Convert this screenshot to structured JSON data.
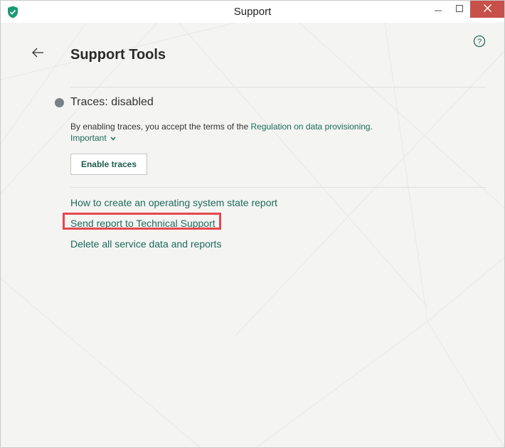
{
  "window": {
    "title": "Support",
    "controls": {
      "minimize": "minimize",
      "maximize": "maximize",
      "close": "close"
    }
  },
  "header": {
    "title": "Support Tools",
    "back_icon": "back-arrow-icon",
    "help_icon": "help-icon"
  },
  "traces": {
    "status": "Traces: disabled",
    "status_color": "#7a8186",
    "terms_prefix": "By enabling traces, you accept the terms of the ",
    "terms_link": "Regulation on data provisioning",
    "terms_suffix": ".",
    "important_label": "Important",
    "enable_button": "Enable traces"
  },
  "actions": [
    {
      "label": "How to create an operating system state report"
    },
    {
      "label": "Send report to Technical Support",
      "highlighted": true
    },
    {
      "label": "Delete all service data and reports"
    }
  ],
  "colors": {
    "link": "#1c6b58",
    "highlight": "#e5474d",
    "close_button": "#c7504a",
    "brand": "#1b9a73"
  }
}
